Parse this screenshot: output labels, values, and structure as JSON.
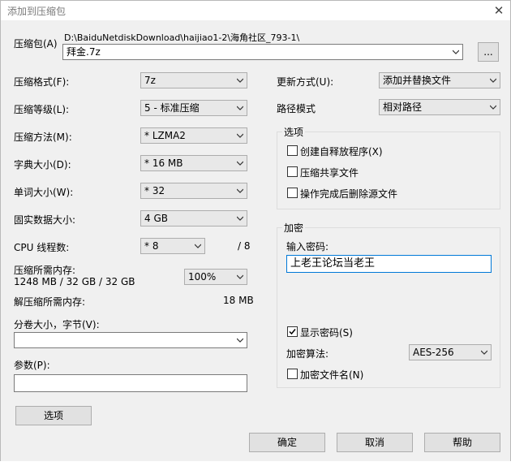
{
  "window": {
    "title": "添加到压缩包"
  },
  "archive": {
    "label": "压缩包(A)",
    "path": "D:\\BaiduNetdiskDownload\\haijiao1-2\\海角社区_793-1\\",
    "filename": "拜金.7z",
    "browse_label": "..."
  },
  "format": {
    "label": "压缩格式(F):",
    "value": "7z"
  },
  "level": {
    "label": "压缩等级(L):",
    "value": "5 - 标准压缩"
  },
  "method": {
    "label": "压缩方法(M):",
    "value": "* LZMA2"
  },
  "dict": {
    "label": "字典大小(D):",
    "value": "* 16 MB"
  },
  "word": {
    "label": "单词大小(W):",
    "value": "* 32"
  },
  "solid": {
    "label": "固实数据大小:",
    "value": "4 GB"
  },
  "cpu": {
    "label": "CPU 线程数:",
    "value": "* 8",
    "total": "/ 8"
  },
  "memory": {
    "label": "压缩所需内存:",
    "detail": "1248 MB / 32 GB / 32 GB",
    "value": "100%"
  },
  "decompress": {
    "label": "解压缩所需内存:",
    "value": "18 MB"
  },
  "split": {
    "label": "分卷大小，字节(V):",
    "value": ""
  },
  "params": {
    "label": "参数(P):",
    "value": ""
  },
  "options_button": "选项",
  "update": {
    "label": "更新方式(U):",
    "value": "添加并替换文件"
  },
  "pathmode": {
    "label": "路径模式",
    "value": "相对路径"
  },
  "options_group": {
    "title": "选项",
    "items": [
      {
        "label": "创建自释放程序(X)",
        "checked": false
      },
      {
        "label": "压缩共享文件",
        "checked": false
      },
      {
        "label": "操作完成后删除源文件",
        "checked": false
      }
    ]
  },
  "encryption": {
    "title": "加密",
    "password_label": "输入密码:",
    "password_value": "上老王论坛当老王",
    "show_password_label": "显示密码(S)",
    "show_password_checked": true,
    "method_label": "加密算法:",
    "method_value": "AES-256",
    "encrypt_names_label": "加密文件名(N)",
    "encrypt_names_checked": false
  },
  "buttons": {
    "ok": "确定",
    "cancel": "取消",
    "help": "帮助"
  }
}
